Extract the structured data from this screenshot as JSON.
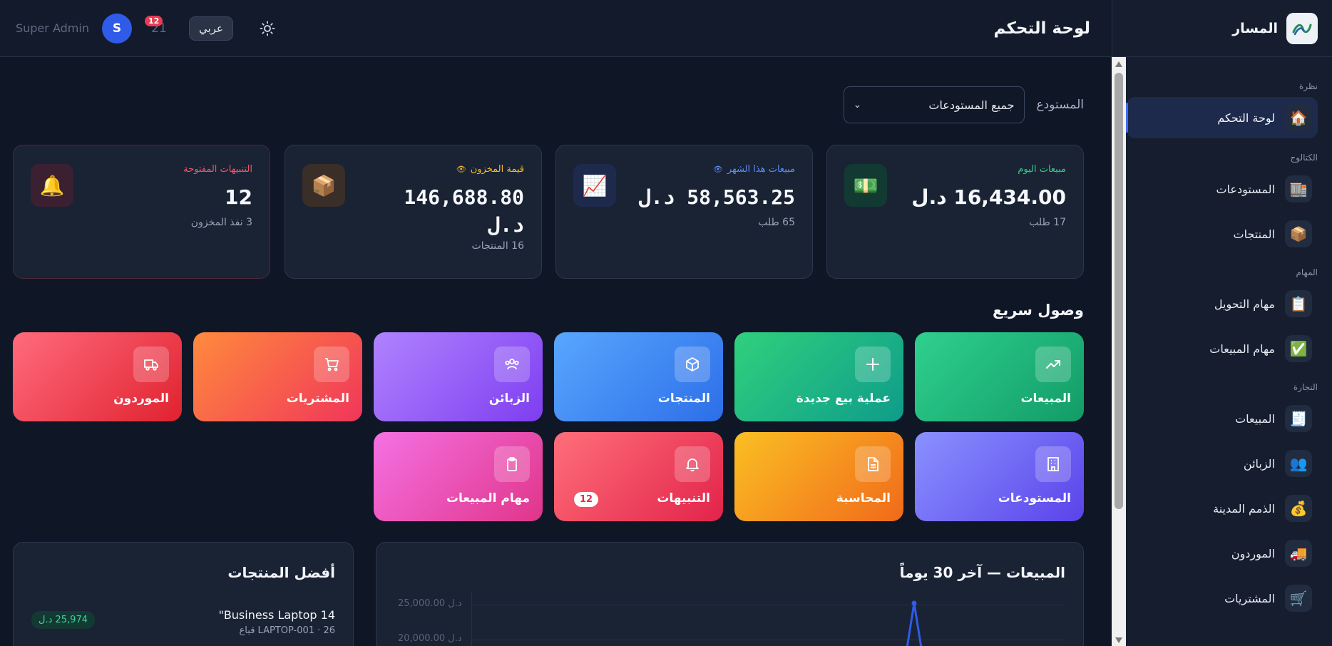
{
  "sidebar": {
    "brand": "المسار",
    "sections": {
      "overview": "نظرة",
      "catalog": "الكتالوج",
      "tasks": "المهام",
      "commerce": "التجارة"
    },
    "items": {
      "dashboard": {
        "label": "لوحة التحكم",
        "icon": "🏠"
      },
      "warehouses": {
        "label": "المستودعات",
        "icon": "🏬"
      },
      "products": {
        "label": "المنتجات",
        "icon": "📦"
      },
      "transfer_tasks": {
        "label": "مهام التحويل",
        "icon": "📋"
      },
      "sales_tasks": {
        "label": "مهام المبيعات",
        "icon": "✅"
      },
      "sales": {
        "label": "المبيعات",
        "icon": "🧾"
      },
      "customers": {
        "label": "الزبائن",
        "icon": "👥"
      },
      "receivables": {
        "label": "الذمم المدينة",
        "icon": "💰"
      },
      "suppliers": {
        "label": "الموردون",
        "icon": "🚚"
      },
      "purchases": {
        "label": "المشتريات",
        "icon": "🛒"
      }
    }
  },
  "topbar": {
    "title": "لوحة التحكم",
    "user_name": "Super Admin",
    "avatar_letter": "S",
    "notification_count": "12",
    "notification_hidden_count": "21",
    "language_button": "عربي"
  },
  "filter": {
    "label": "المستودع",
    "selected": "جميع المستودعات"
  },
  "stats": {
    "today": {
      "label": "مبيعات اليوم",
      "value": "16,434.00 د.ل",
      "sub": "17 طلب",
      "color": "#35c98a"
    },
    "month": {
      "label": "مبيعات هذا الشهر",
      "value": "58,563.25 د.ل",
      "sub": "65 طلب",
      "color": "#5b8cf5"
    },
    "inventory": {
      "label": "قيمة المخزون",
      "value_line1": "146,688.80",
      "value_line2": "د.ل",
      "sub": "16 المنتجات",
      "color": "#f5b731"
    },
    "alerts": {
      "label": "التنبيهات المفتوحة",
      "value": "12",
      "sub": "3 نفذ المخزون",
      "color": "#f0566e"
    }
  },
  "quick_access": {
    "title": "وصول سريع",
    "items": {
      "sales": "المبيعات",
      "new_sale": "عملية بيع جديدة",
      "products": "المنتجات",
      "customers": "الزبائن",
      "purchases": "المشتريات",
      "suppliers": "الموردون",
      "warehouses": "المستودعات",
      "accounting": "المحاسبة",
      "alerts": "التنبيهات",
      "alerts_badge": "12",
      "sales_tasks": "مهام المبيعات"
    }
  },
  "sales_chart": {
    "title": "المبيعات — آخر 30 يوماً",
    "y_ticks": [
      "25,000.00 د.ل",
      "20,000.00 د.ل"
    ]
  },
  "chart_data": {
    "type": "line",
    "title": "المبيعات — آخر 30 يوماً",
    "y_tick_labels": [
      "25,000.00 د.ل",
      "20,000.00 د.ل"
    ],
    "series": [
      {
        "values": [
          25000
        ]
      }
    ],
    "color": "#2f5be8"
  },
  "top_products": {
    "title": "أفضل المنتجات",
    "items": [
      {
        "name": "Business Laptop 14\"",
        "meta": "LAPTOP-001 · 26 قباع",
        "amount": "25,974 د.ل"
      }
    ]
  }
}
